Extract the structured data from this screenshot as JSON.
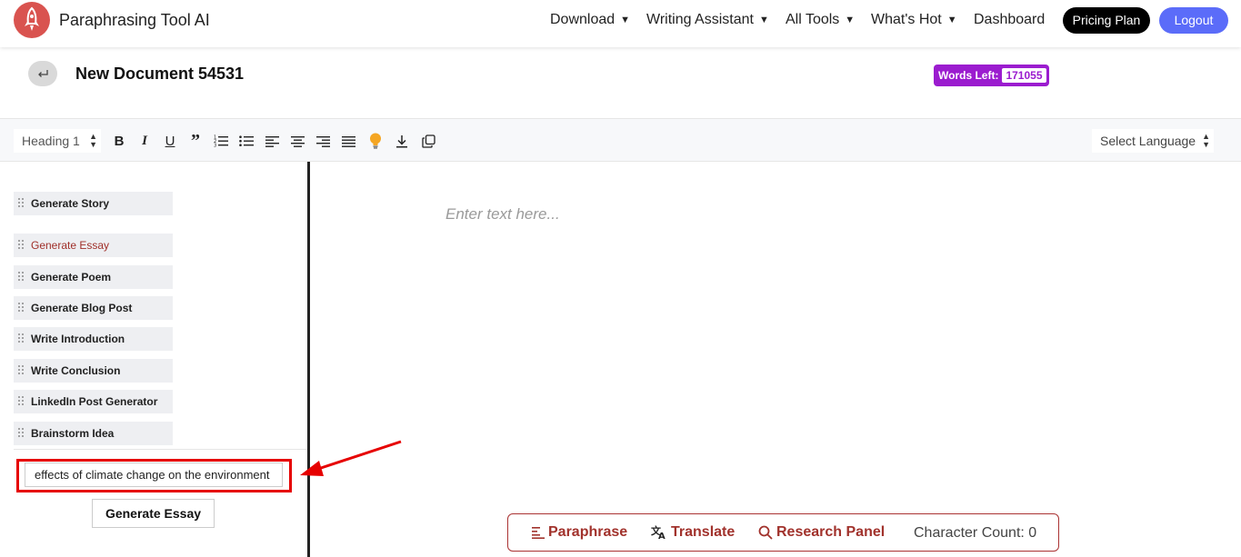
{
  "header": {
    "brand": "Paraphrasing Tool AI",
    "nav": [
      {
        "label": "Download",
        "caret": "▼"
      },
      {
        "label": "Writing Assistant",
        "caret": "▼"
      },
      {
        "label": "All Tools",
        "caret": "▼"
      },
      {
        "label": "What's Hot",
        "caret": "▼"
      },
      {
        "label": "Dashboard"
      }
    ],
    "pricing_label": "Pricing Plan",
    "logout_label": "Logout"
  },
  "document": {
    "title": "New Document 54531",
    "words_left_label": "Words Left:",
    "words_left_value": "171055"
  },
  "toolbar": {
    "heading_value": "Heading 1",
    "language_value": "Select Language",
    "icons": [
      "bold-icon",
      "italic-icon",
      "underline-icon",
      "quote-icon",
      "ordered-list-icon",
      "bullet-list-icon",
      "align-left-icon",
      "align-center-icon",
      "align-right-icon",
      "align-justify-icon",
      "lightbulb-icon",
      "download-icon",
      "copy-icon"
    ]
  },
  "sidebar": {
    "items": [
      {
        "label": "Generate Story"
      },
      {
        "label": "Generate Essay",
        "active": true
      },
      {
        "label": "Generate Poem"
      },
      {
        "label": "Generate Blog Post"
      },
      {
        "label": "Write Introduction"
      },
      {
        "label": "Write Conclusion"
      },
      {
        "label": "LinkedIn Post Generator"
      },
      {
        "label": "Brainstorm Idea"
      }
    ],
    "topic_value": "effects of climate change on the environment",
    "generate_label": "Generate Essay"
  },
  "editor": {
    "placeholder": "Enter text here..."
  },
  "action_bar": {
    "paraphrase": "Paraphrase",
    "translate": "Translate",
    "research": "Research Panel",
    "char_count": "Character Count: 0"
  },
  "colors": {
    "accent_red": "#a1322c",
    "purple": "#9b1ccf",
    "logout_blue": "#5b6cf9",
    "annotation_red": "#e60000"
  }
}
